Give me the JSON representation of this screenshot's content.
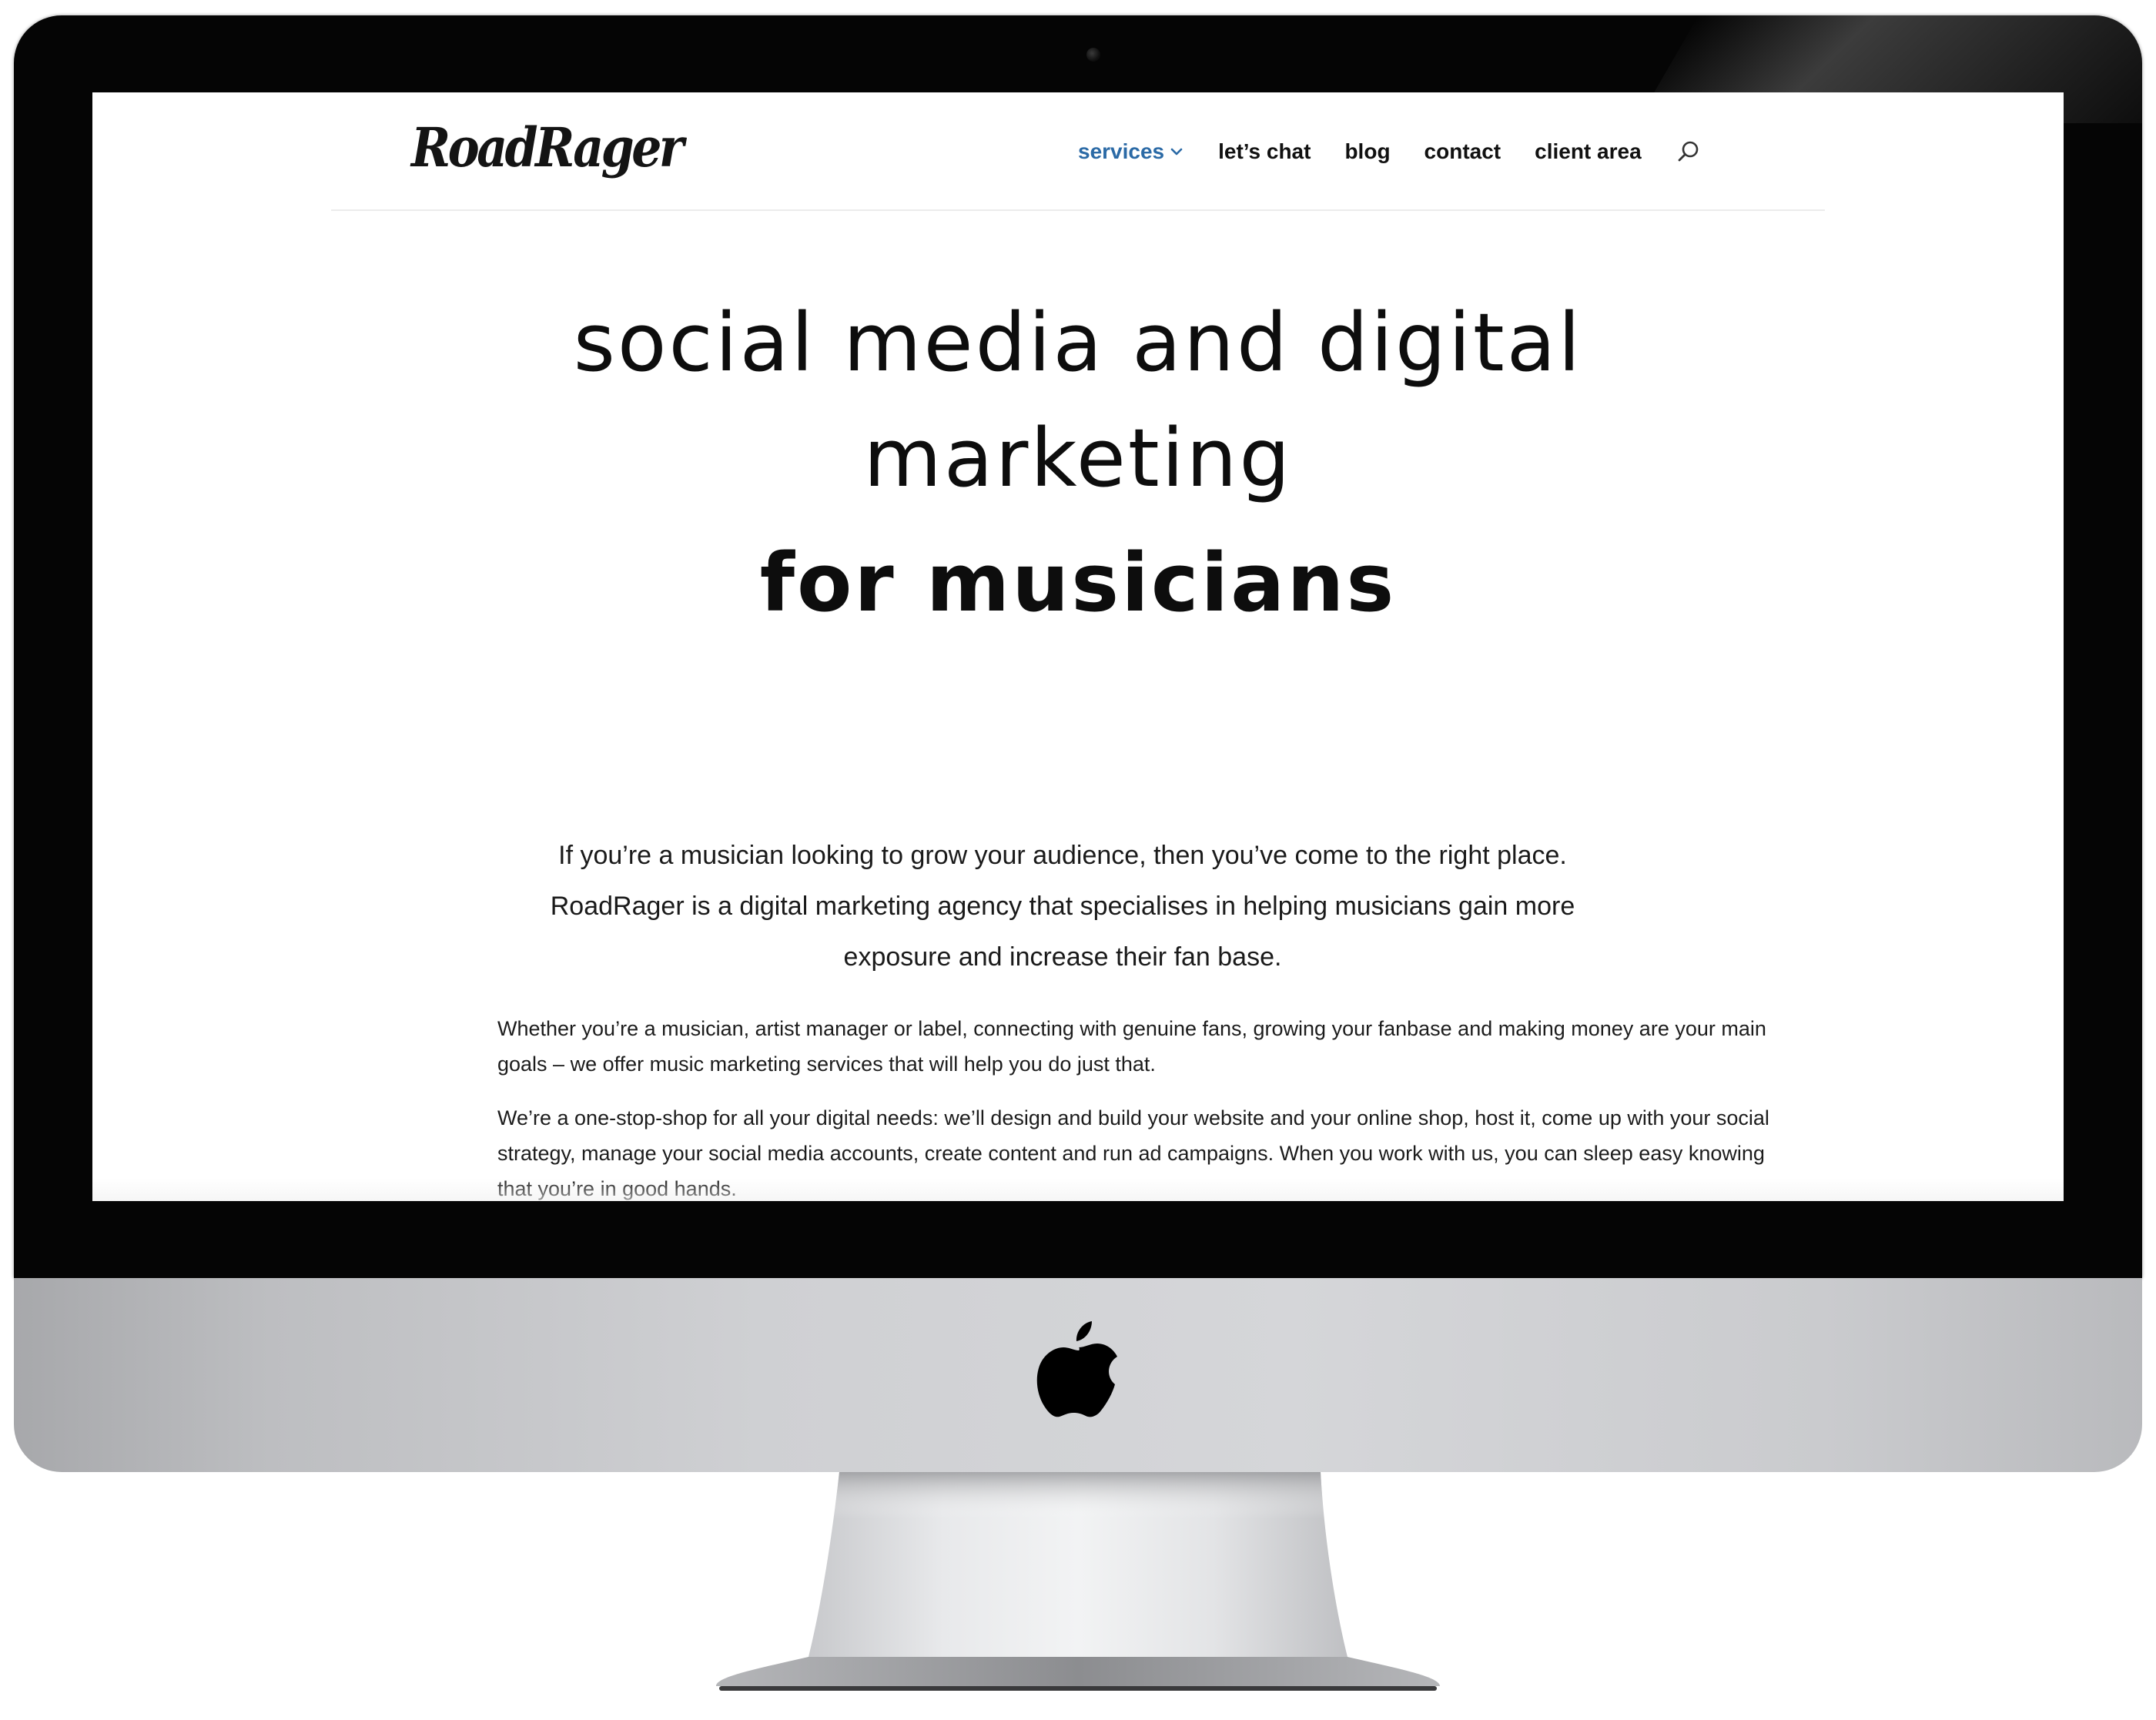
{
  "brand": {
    "logo_text": "RoadRager"
  },
  "nav": {
    "items": [
      {
        "label": "services",
        "active": true
      },
      {
        "label": "let’s chat"
      },
      {
        "label": "blog"
      },
      {
        "label": "contact"
      },
      {
        "label": "client area"
      }
    ],
    "active_color": "#2b6aa6"
  },
  "hero": {
    "line1": "social media and digital",
    "line2": "marketing",
    "line3": "for musicians"
  },
  "intro": {
    "text": "If you’re a musician looking to grow your audience, then you’ve come to the right place. RoadRager is a digital marketing agency that specialises in helping musicians gain more exposure and increase their fan base."
  },
  "body": {
    "para1": "Whether you’re a musician, artist manager or label, connecting with genuine fans, growing your fanbase and making money are your main goals –  we offer music marketing services that will help you do just that.",
    "para2": "We’re a one-stop-shop for all your digital needs: we’ll design and build your website and your online shop, host it, come up with your social strategy, manage your social media accounts, create content and run ad campaigns. When you work with us, you can sleep easy knowing that you’re in good hands."
  },
  "icons": {
    "search": "search-icon",
    "dropdown": "chevron-down-icon",
    "device_logo": "apple-icon",
    "camera": "camera-icon"
  }
}
